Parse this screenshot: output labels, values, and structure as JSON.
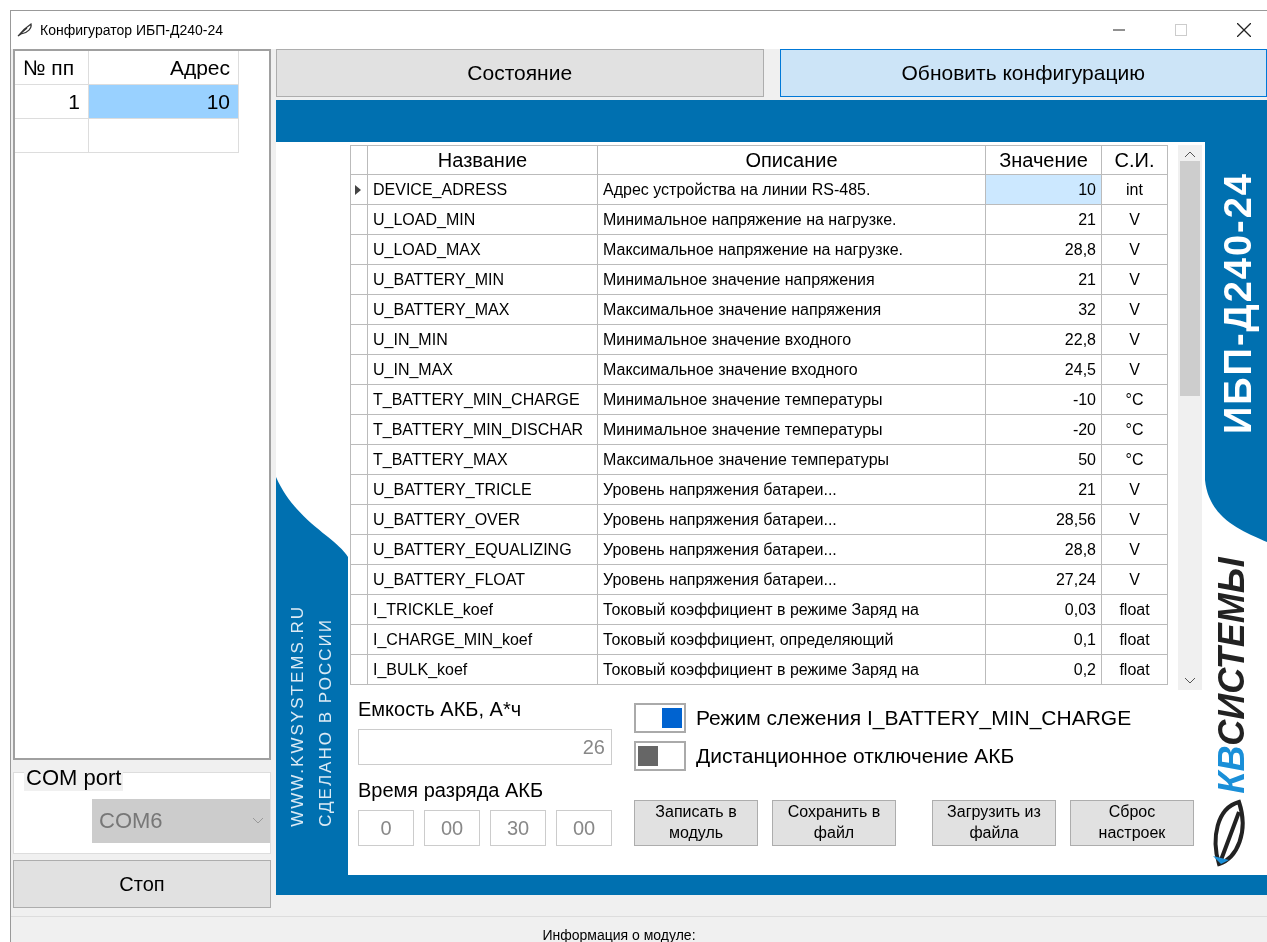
{
  "window": {
    "title": "Конфигуратор ИБП-Д240-24"
  },
  "address_grid": {
    "columns": [
      "№ пп",
      "Адрес"
    ],
    "rows": [
      {
        "number": "1",
        "address": "10",
        "selected": true
      }
    ]
  },
  "com_port": {
    "label": "COM port",
    "value": "COM6",
    "disabled": true
  },
  "stop_button": "Стоп",
  "tabs": [
    {
      "label": "Состояние",
      "selected": false
    },
    {
      "label": "Обновить конфигурацию",
      "selected": true
    }
  ],
  "branding": {
    "site": "WWW.KWSYSTEMS.RU",
    "made_in": "СДЕЛАНО В РОССИИ",
    "product": "ИБП-Д240-24",
    "logo_prefix": "КВ",
    "logo_name": "СИСТЕМЫ"
  },
  "params": {
    "columns": [
      "Название",
      "Описание",
      "Значение",
      "С.И."
    ],
    "rows": [
      {
        "name": "DEVICE_ADRESS",
        "description": "Адрес устройства на линии RS-485.",
        "value": "10",
        "unit": "int",
        "selected": true
      },
      {
        "name": "U_LOAD_MIN",
        "description": "Минимальное напряжение на нагрузке.",
        "value": "21",
        "unit": "V",
        "selected": false
      },
      {
        "name": "U_LOAD_MAX",
        "description": "Максимальное напряжение на нагрузке.",
        "value": "28,8",
        "unit": "V",
        "selected": false
      },
      {
        "name": "U_BATTERY_MIN",
        "description": "Минимальное значение напряжения",
        "value": "21",
        "unit": "V",
        "selected": false
      },
      {
        "name": "U_BATTERY_MAX",
        "description": "Максимальное значение напряжения",
        "value": "32",
        "unit": "V",
        "selected": false
      },
      {
        "name": "U_IN_MIN",
        "description": "Минимальное значение входного",
        "value": "22,8",
        "unit": "V",
        "selected": false
      },
      {
        "name": "U_IN_MAX",
        "description": "Максимальное значение входного",
        "value": "24,5",
        "unit": "V",
        "selected": false
      },
      {
        "name": "T_BATTERY_MIN_CHARGE",
        "description": "Минимальное значение температуры",
        "value": "-10",
        "unit": "°C",
        "selected": false
      },
      {
        "name": "T_BATTERY_MIN_DISCHAR",
        "description": "Минимальное значение температуры",
        "value": "-20",
        "unit": "°C",
        "selected": false
      },
      {
        "name": "T_BATTERY_MAX",
        "description": "Максимальное значение температуры",
        "value": "50",
        "unit": "°C",
        "selected": false
      },
      {
        "name": "U_BATTERY_TRICLE",
        "description": "Уровень напряжения батареи...",
        "value": "21",
        "unit": "V",
        "selected": false
      },
      {
        "name": "U_BATTERY_OVER",
        "description": "Уровень напряжения батареи...",
        "value": "28,56",
        "unit": "V",
        "selected": false
      },
      {
        "name": "U_BATTERY_EQUALIZING",
        "description": "Уровень напряжения батареи...",
        "value": "28,8",
        "unit": "V",
        "selected": false
      },
      {
        "name": "U_BATTERY_FLOAT",
        "description": "Уровень напряжения батареи...",
        "value": "27,24",
        "unit": "V",
        "selected": false
      },
      {
        "name": "I_TRICKLE_koef",
        "description": "Токовый коэффициент в режиме Заряд на",
        "value": "0,03",
        "unit": "float",
        "selected": false
      },
      {
        "name": "I_CHARGE_MIN_koef",
        "description": "Токовый коэффициент, определяющий",
        "value": "0,1",
        "unit": "float",
        "selected": false
      },
      {
        "name": "I_BULK_koef",
        "description": "Токовый коэффициент в режиме Заряд на",
        "value": "0,2",
        "unit": "float",
        "selected": false
      }
    ]
  },
  "capacity": {
    "label": "Емкость АКБ, А*ч",
    "value": "26"
  },
  "discharge_time": {
    "label": "Время разряда АКБ",
    "fields": [
      "0",
      "00",
      "30",
      "00"
    ]
  },
  "toggles": [
    {
      "label": "Режим слежения I_BATTERY_MIN_CHARGE",
      "on": true
    },
    {
      "label": "Дистанционное отключение АКБ",
      "on": false
    }
  ],
  "actions": [
    "Записать в модуль",
    "Сохранить в файл",
    "Загрузить из файла",
    "Сброс настроек"
  ],
  "status_bar": {
    "text": "Информация о модуле:"
  }
}
